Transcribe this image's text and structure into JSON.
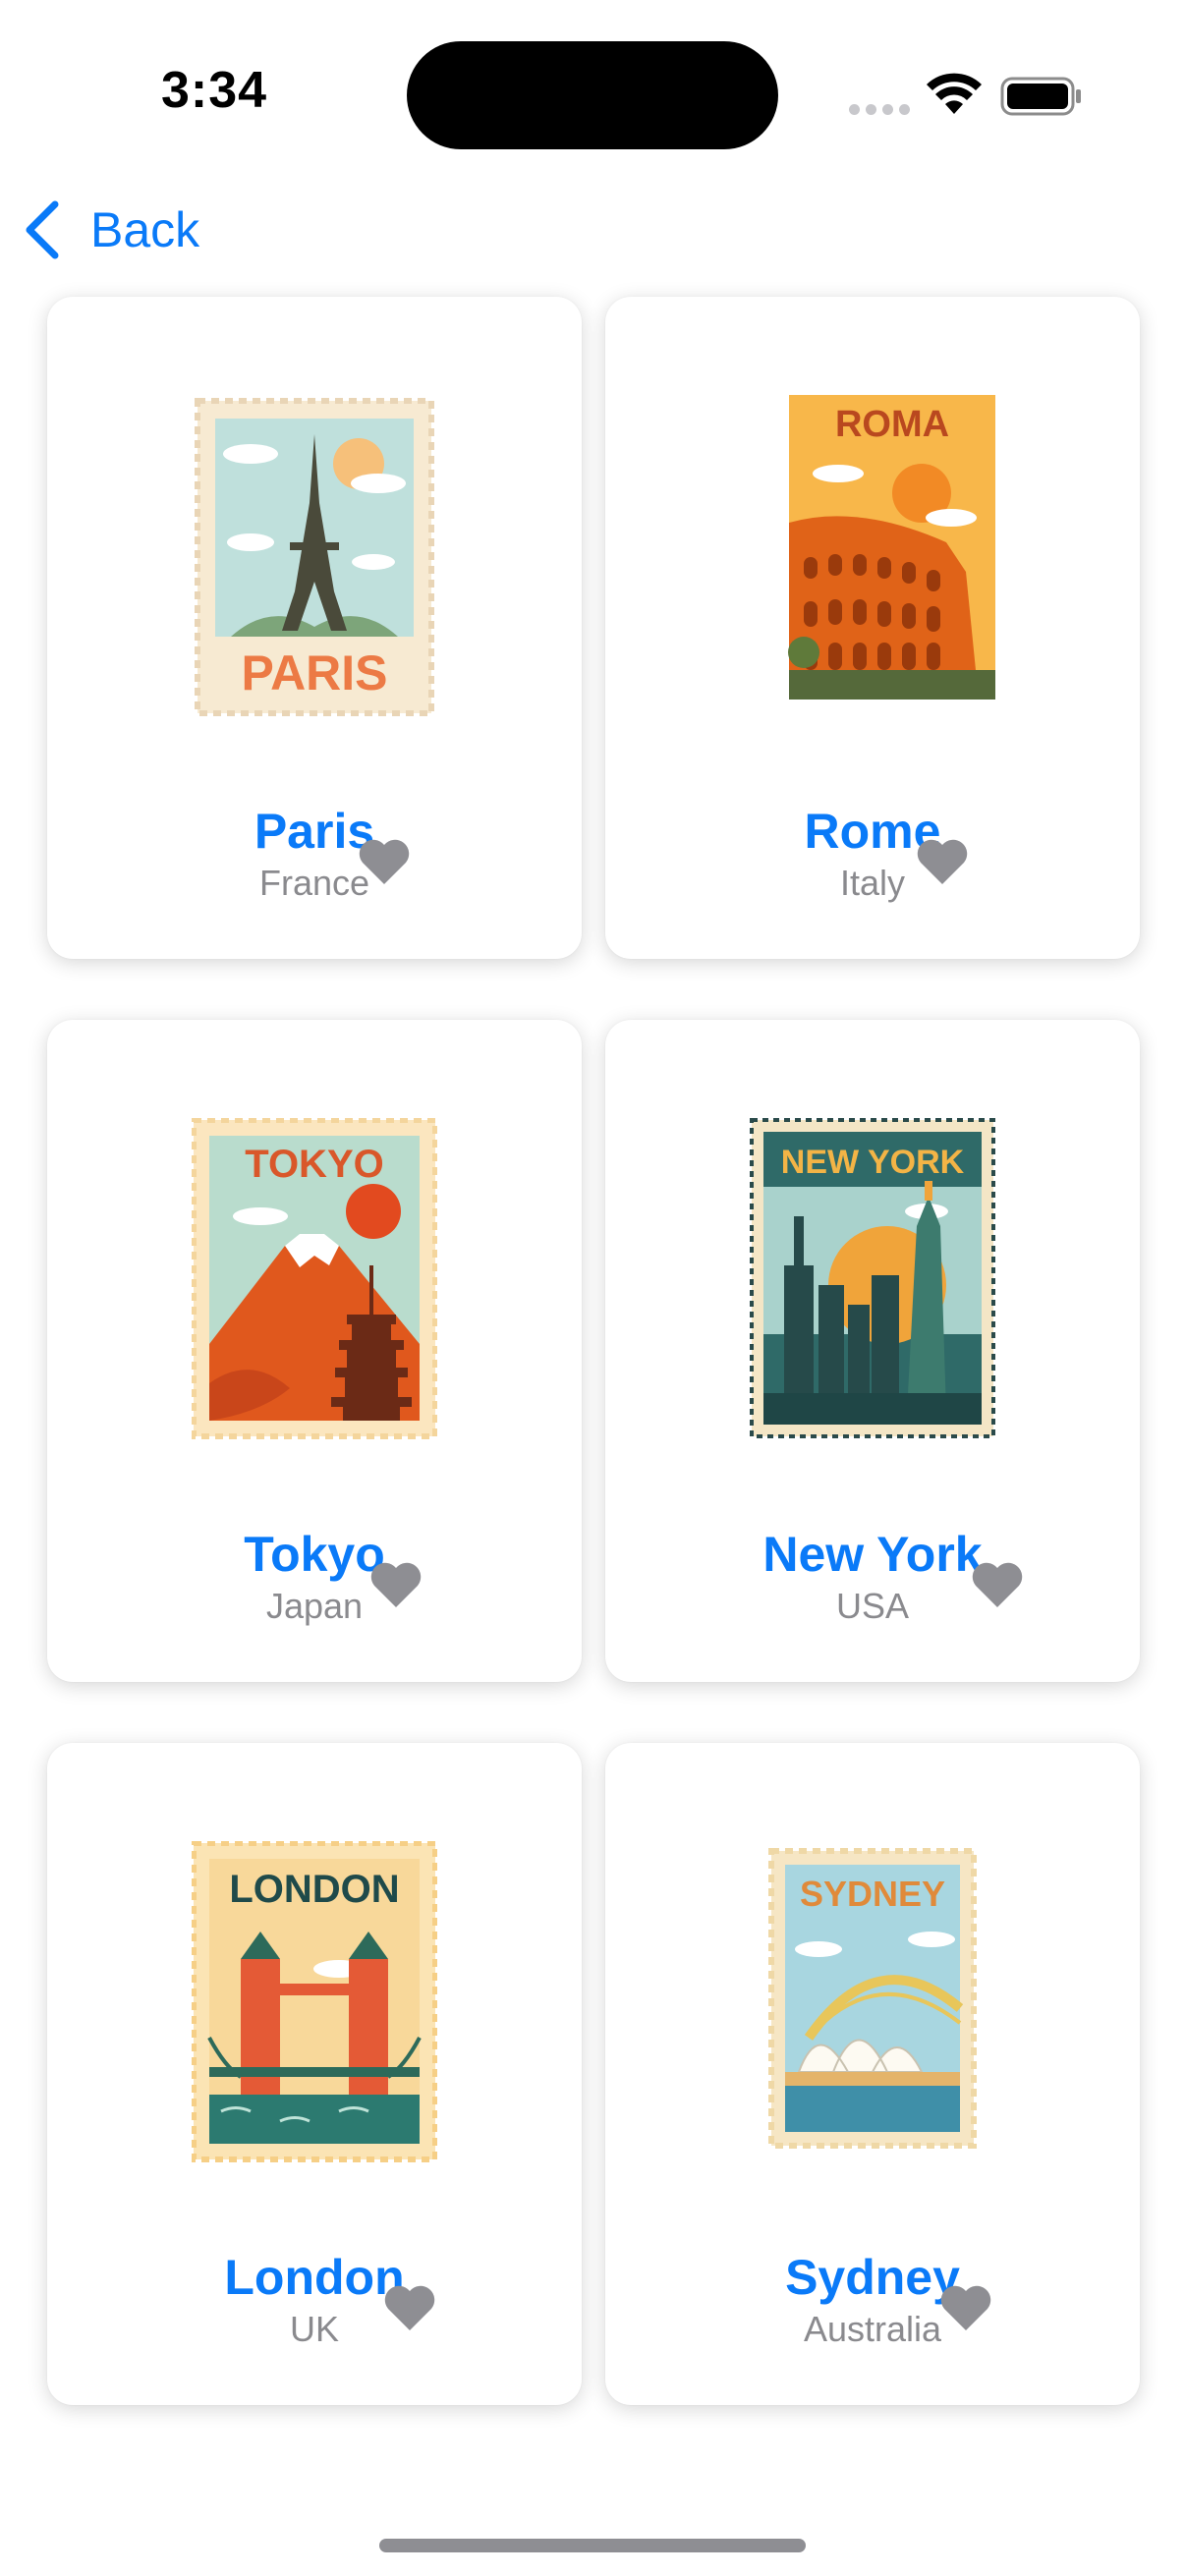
{
  "status_bar": {
    "time": "3:34"
  },
  "nav": {
    "back_label": "Back"
  },
  "accent_color": "#0A7AF8",
  "heart_color": "#8E8E93",
  "cards": [
    {
      "city": "Paris",
      "country": "France",
      "stamp_text": "PARIS",
      "favorite": false
    },
    {
      "city": "Rome",
      "country": "Italy",
      "stamp_text": "ROMA",
      "favorite": false
    },
    {
      "city": "Tokyo",
      "country": "Japan",
      "stamp_text": "TOKYO",
      "favorite": false
    },
    {
      "city": "New York",
      "country": "USA",
      "stamp_text": "NEW YORK",
      "favorite": false
    },
    {
      "city": "London",
      "country": "UK",
      "stamp_text": "LONDON",
      "favorite": false
    },
    {
      "city": "Sydney",
      "country": "Australia",
      "stamp_text": "SYDNEY",
      "favorite": false
    }
  ]
}
